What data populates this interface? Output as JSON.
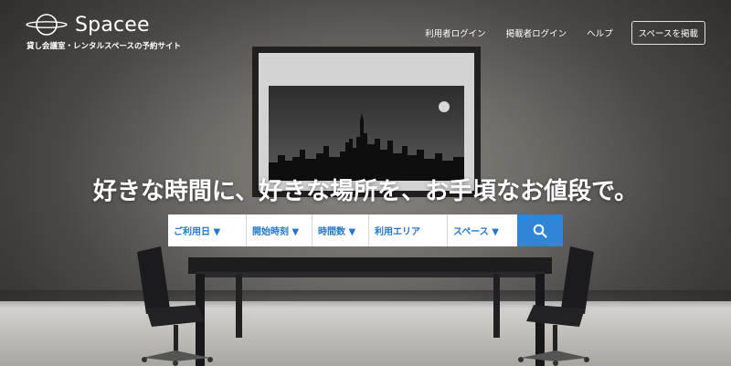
{
  "brand": {
    "name": "Spacee",
    "tagline": "貸し会議室・レンタルスペースの予約サイト",
    "logo_icon": "planet-ring-icon"
  },
  "nav": {
    "user_login": "利用者ログイン",
    "host_login": "掲載者ログイン",
    "help": "ヘルプ",
    "list_space": "スペースを掲載"
  },
  "hero": {
    "headline": "好きな時間に、好きな場所を、お手頃なお値段で。"
  },
  "search": {
    "date": "ご利用日 ▼",
    "start_time": "開始時刻 ▼",
    "hours": "時間数 ▼",
    "area": "利用エリア",
    "space": "スペース ▼",
    "button_icon": "search-icon"
  },
  "colors": {
    "accent": "#2f86d6",
    "field_text": "#2277cc"
  }
}
